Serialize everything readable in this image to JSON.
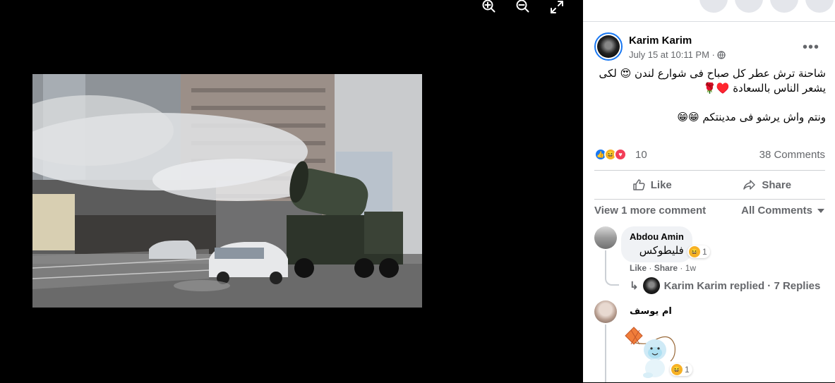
{
  "post": {
    "author": "Karim Karim",
    "time": "July 15 at 10:11 PM · ",
    "privacy_icon": "globe-icon",
    "text_line1": "شاحنة ترش عطر كل صباح فى شوارع لندن 😍 لكى يشعر الناس بالسعادة ♥️🌹",
    "text_line2": "ونتم واش يرشو فى مدينتكم 😁😁",
    "reaction_count": "10",
    "comments_count": "38 Comments",
    "like_label": "Like",
    "share_label": "Share",
    "view_more": "View 1 more comment",
    "all_comments": "All Comments"
  },
  "comments": [
    {
      "name": "Abdou Amin",
      "text": "فليطوكس",
      "reactions": "1",
      "like": "Like",
      "share": "Share",
      "age": "1w",
      "reply_text": "Karim Karim replied · 7 Replies"
    },
    {
      "name": "ام يوسف",
      "reactions": "1"
    }
  ],
  "icons": {
    "zoom_in": "zoom-in-icon",
    "zoom_out": "zoom-out-icon",
    "fullscreen": "fullscreen-icon"
  },
  "colors": {
    "accent": "#1877f2",
    "text_secondary": "#65676b"
  }
}
